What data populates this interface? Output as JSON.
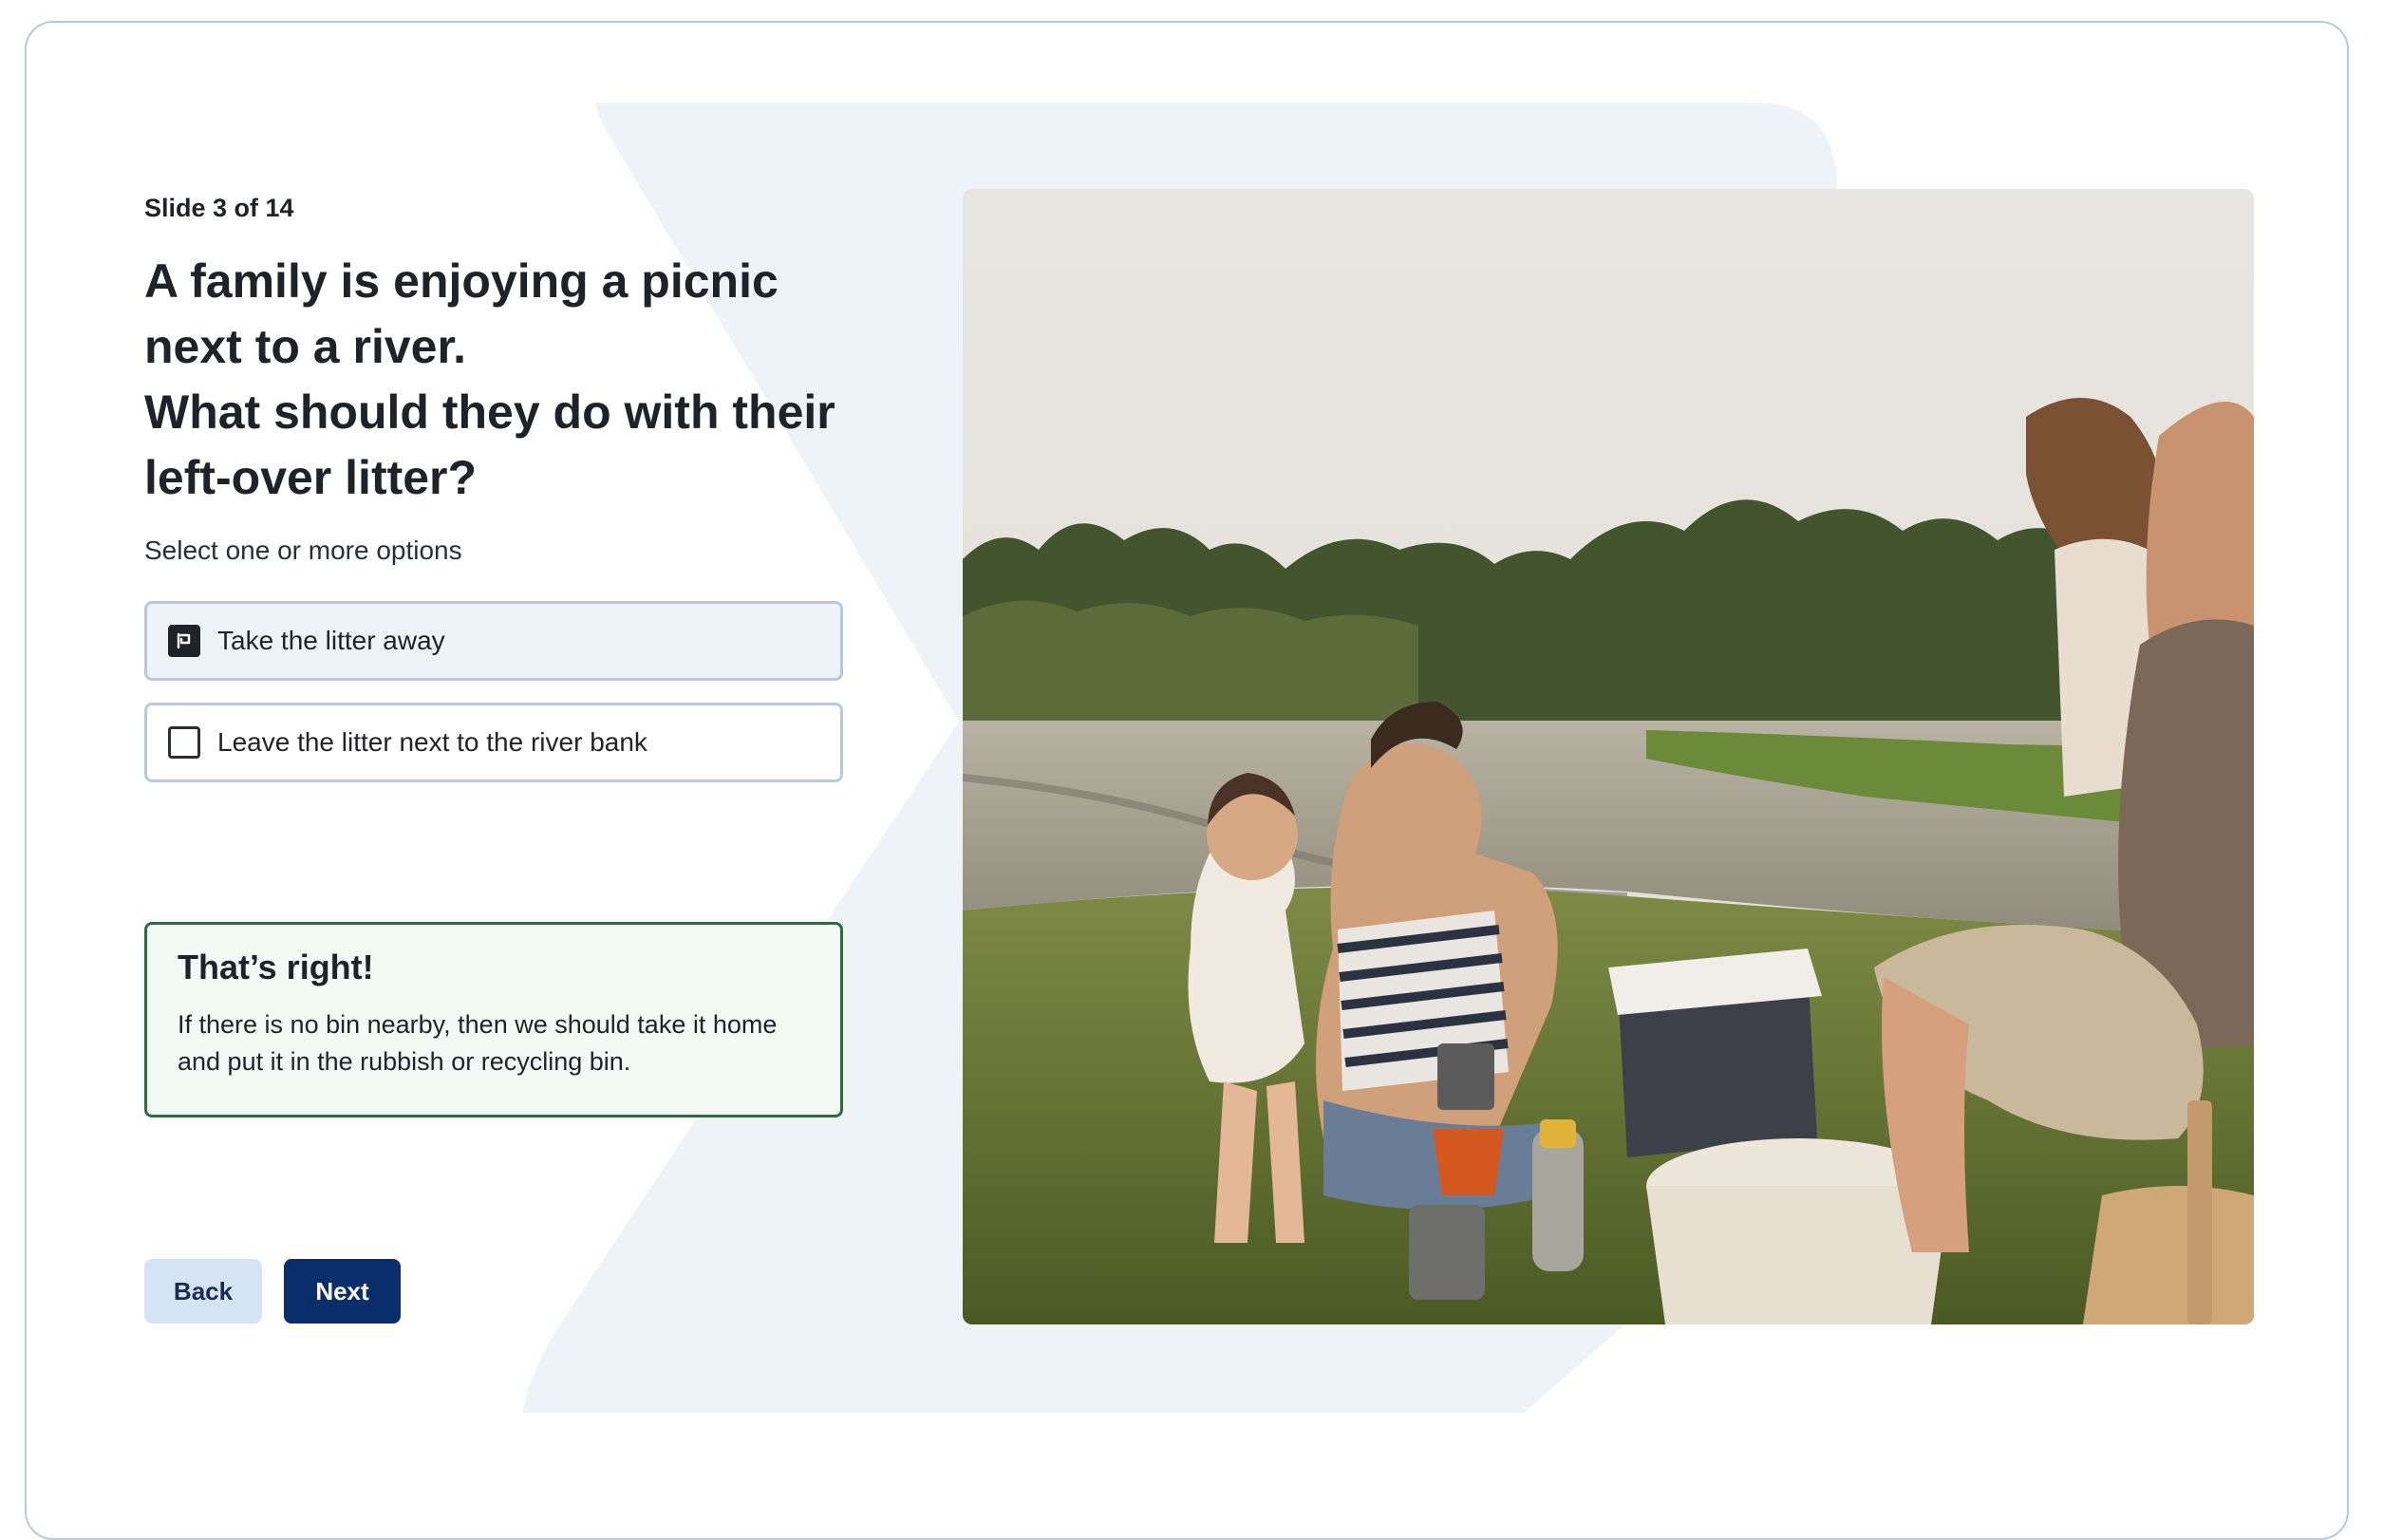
{
  "slide": {
    "counter": "Slide 3 of 14",
    "question_lines": [
      "A family is enjoying a picnic",
      "next to a river.",
      "What should they do with their",
      "left-over litter?"
    ],
    "instructions": "Select one or more options"
  },
  "options": [
    {
      "label": "Take the litter away",
      "checked": true
    },
    {
      "label": "Leave the litter next to the river bank",
      "checked": false
    }
  ],
  "feedback": {
    "title": "That’s right!",
    "body": "If there is no bin nearby, then we should take it home and put it in the rubbish or recycling bin."
  },
  "navigation": {
    "back_label": "Back",
    "next_label": "Next"
  },
  "colors": {
    "accent": "#0b2e6b",
    "secondary_button": "#d6e3f3",
    "feedback_border": "#2e6b3f",
    "feedback_background": "#f3f9f4",
    "frame_border": "#b9c9dc",
    "background_shape": "#eef3f8"
  },
  "icons": {
    "checked": "checkbox-checked-icon",
    "unchecked": "checkbox-unchecked-icon"
  }
}
